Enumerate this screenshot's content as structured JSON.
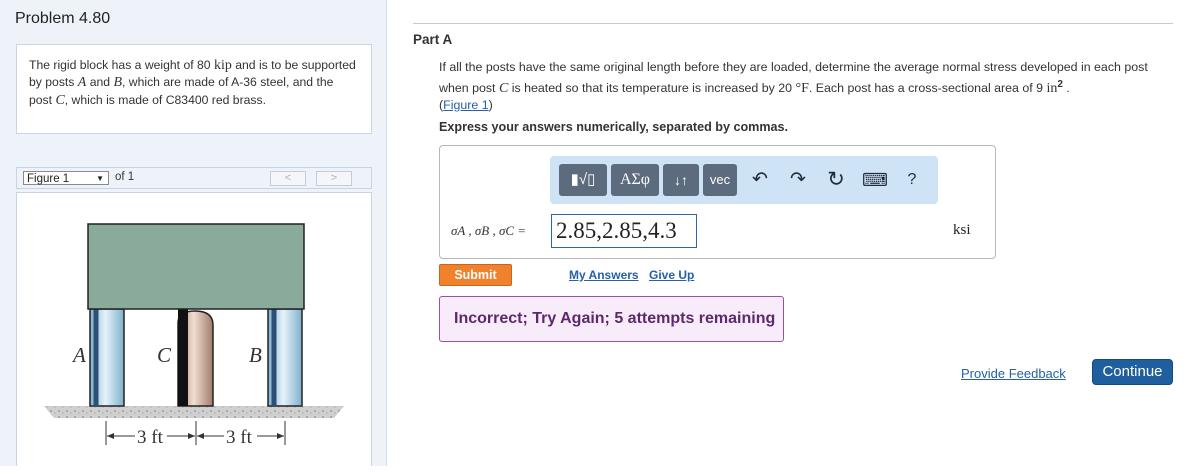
{
  "problem": {
    "title": "Problem 4.80",
    "statement": {
      "t1": "The rigid block has a weight of 80 ",
      "u1": "kip",
      "t2": " and is to be supported by posts ",
      "a": "A",
      "t3": " and ",
      "b": "B",
      "t4": ", which are made of A-36 steel, and the post ",
      "c": "C",
      "t5": ", which is made of C83400 red brass."
    }
  },
  "figure_nav": {
    "selected": "Figure 1",
    "of_label": "of 1",
    "prev": "<",
    "next": ">"
  },
  "figure": {
    "label_a": "A",
    "label_b": "B",
    "label_c": "C",
    "dim_left": "3 ft",
    "dim_right": "3 ft",
    "colors": {
      "block": "#8aab9b",
      "steel_post": "#a9cde2",
      "brass_post": "#c9a693",
      "ground": "#cfcfcf"
    }
  },
  "part": {
    "label": "Part A",
    "question": {
      "t1": "If all the posts have the same original length before they are loaded, determine the average normal stress developed in each post when post ",
      "c": "C",
      "t2": " is heated so that its temperature is increased by 20 ",
      "deg": "°F",
      "t3": ". Each post has a cross-sectional area of 9 ",
      "in": "in",
      "sup": "2",
      "t4": " .",
      "link": "Figure 1"
    },
    "instruction": "Express your answers numerically, separated by commas.",
    "toolbar": {
      "templates": "▮√▯",
      "symbols": "ΑΣφ",
      "arrows": "↓↑",
      "vec": "vec",
      "undo": "↶",
      "redo": "↷",
      "reset": "↻",
      "keyboard": "⌨",
      "help": "?"
    },
    "variable_label": "σA , σB , σC =",
    "answer_value": "2.85,2.85,4.3",
    "unit": "ksi",
    "submit_label": "Submit",
    "my_answers_label": "My Answers",
    "give_up_label": "Give Up",
    "feedback": "Incorrect; Try Again; 5 attempts remaining"
  },
  "footer": {
    "provide_feedback": "Provide Feedback",
    "continue": "Continue"
  },
  "colors": {
    "accent": "#2560a8",
    "submit": "#f0812d",
    "feedback_bg": "#f9ecfa",
    "continue": "#1f5f9e"
  }
}
